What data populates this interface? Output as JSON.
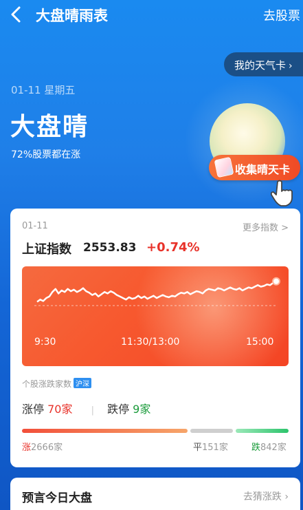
{
  "header": {
    "title": "大盘晴雨表",
    "right_link": "去股票"
  },
  "weather_card_btn": {
    "label": "我的天气卡",
    "chevron": "›"
  },
  "hero": {
    "date": "01-11 星期五",
    "state": "大盘晴",
    "summary": "72%股票都在涨",
    "collect_btn": "收集晴天卡"
  },
  "index_card": {
    "date": "01-11",
    "more_link": "更多指数 >",
    "name": "上证指数",
    "value": "2553.83",
    "change": "+0.74%",
    "time_labels": [
      "9:30",
      "11:30/13:00",
      "15:00"
    ]
  },
  "chart_data": {
    "type": "line",
    "title": "",
    "x_ticks": [
      "9:30",
      "11:30/13:00",
      "15:00"
    ],
    "values": [
      0.05,
      0.08,
      0.06,
      0.1,
      0.12,
      0.18,
      0.22,
      0.16,
      0.2,
      0.18,
      0.22,
      0.19,
      0.21,
      0.18,
      0.2,
      0.23,
      0.19,
      0.17,
      0.14,
      0.16,
      0.12,
      0.15,
      0.18,
      0.16,
      0.19,
      0.17,
      0.14,
      0.12,
      0.1,
      0.08,
      0.11,
      0.09,
      0.1,
      0.13,
      0.1,
      0.12,
      0.09,
      0.11,
      0.13,
      0.1,
      0.12,
      0.14,
      0.12,
      0.11,
      0.13,
      0.12,
      0.15,
      0.17,
      0.16,
      0.18,
      0.15,
      0.17,
      0.19,
      0.18,
      0.16,
      0.2,
      0.22,
      0.21,
      0.2,
      0.23,
      0.22,
      0.2,
      0.22,
      0.24,
      0.22,
      0.21,
      0.23,
      0.2,
      0.22,
      0.24,
      0.23,
      0.25,
      0.27,
      0.25,
      0.26,
      0.28,
      0.27,
      0.3,
      0.32
    ],
    "baseline": 0,
    "line_color": "#ffffff"
  },
  "breadth": {
    "title": "个股涨跌家数",
    "badge": "沪深",
    "limit_up_label": "涨停",
    "limit_up_value": "70家",
    "separator": "|",
    "limit_down_label": "跌停",
    "limit_down_value": "9家",
    "up_label": "涨",
    "up_count": "2666家",
    "flat_label": "平",
    "flat_count": "151家",
    "down_label": "跌",
    "down_count": "842家",
    "colors": {
      "up": "#f26a4b",
      "flat": "#cfcfcf",
      "down": "#3ccf7c"
    }
  },
  "predict": {
    "title": "预言今日大盘",
    "link": "去猜涨跌",
    "chevron": "›"
  }
}
